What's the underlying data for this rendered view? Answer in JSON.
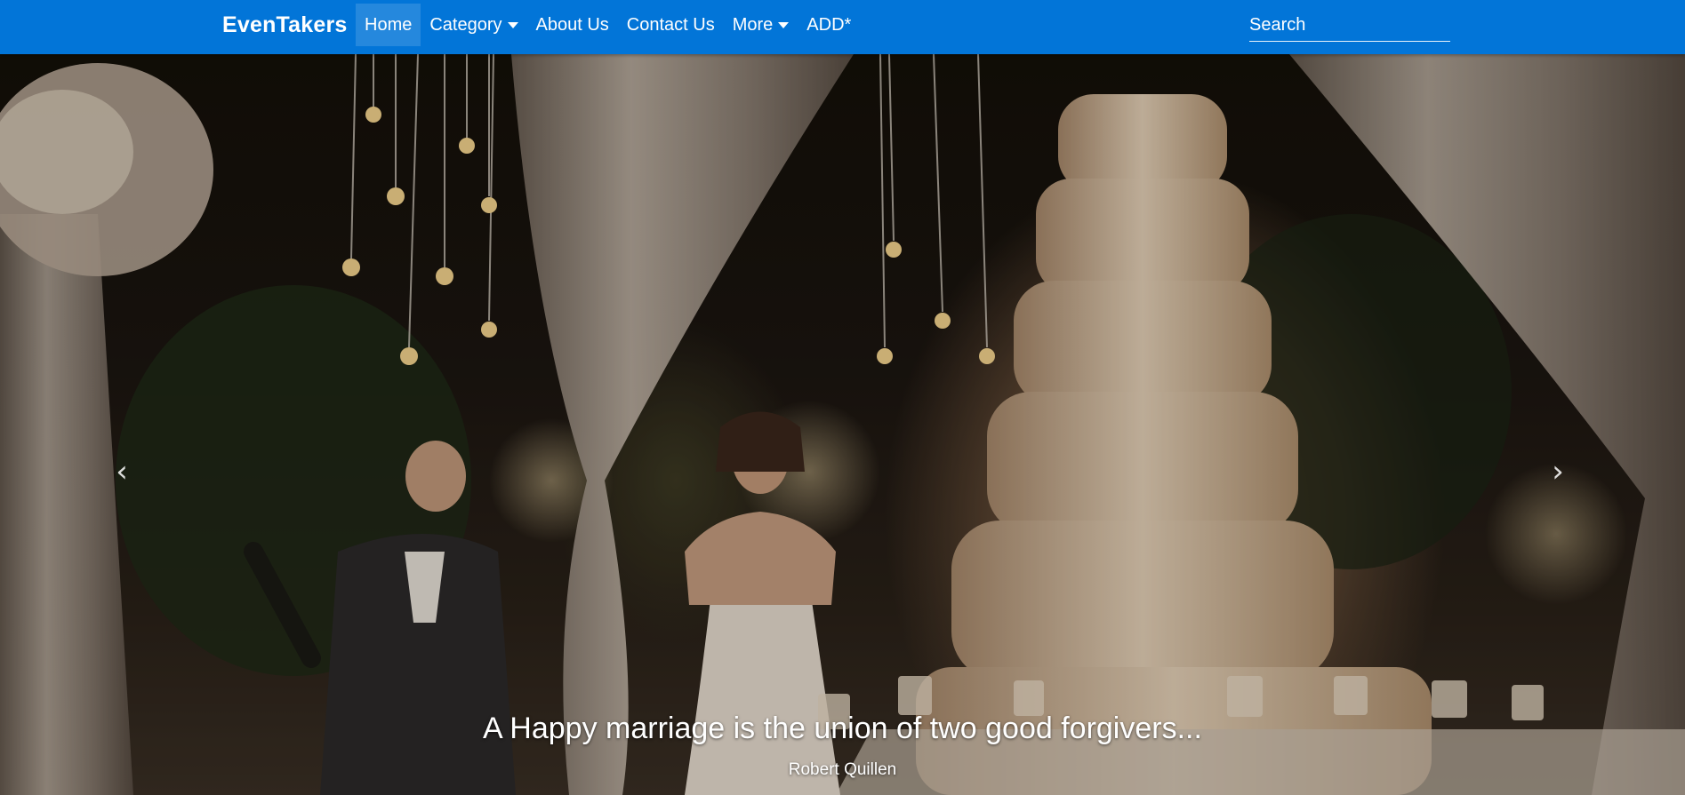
{
  "navbar": {
    "brand": "EvenTakers",
    "items": [
      {
        "label": "Home",
        "active": true
      },
      {
        "label": "Category",
        "dropdown": true
      },
      {
        "label": "About Us"
      },
      {
        "label": "Contact Us"
      },
      {
        "label": "More",
        "dropdown": true
      },
      {
        "label": "ADD*"
      }
    ],
    "search_placeholder": "Search",
    "background": "#0275d8"
  },
  "carousel": {
    "prev_icon": "chevron-left-icon",
    "next_icon": "chevron-right-icon",
    "slide": {
      "image": "wedding-cake-couple-photo",
      "quote": "A Happy marriage is the union of two good forgivers...",
      "author": "Robert Quillen"
    }
  }
}
